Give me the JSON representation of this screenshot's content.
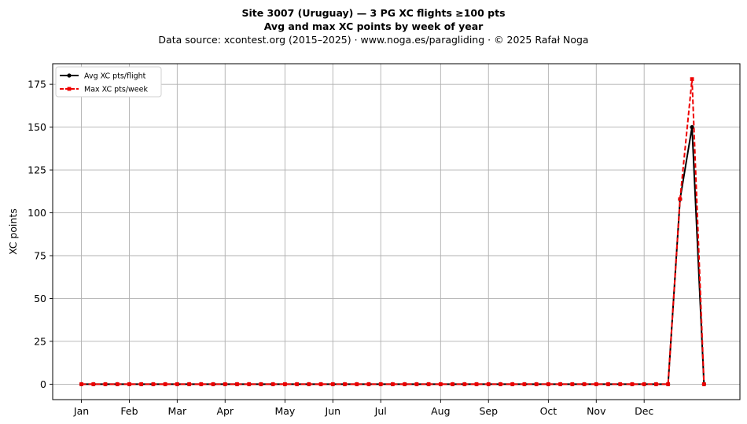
{
  "title": {
    "line1": "Site 3007 (Uruguay)  —  3 PG XC flights ≥100 pts",
    "line2": "Avg and max XC points by week of year",
    "line3": "Data source: xcontest.org (2015–2025)  ·  www.noga.es/paragliding  ·  © 2025 Rafał Noga"
  },
  "chart_data": {
    "type": "line",
    "title": "Site 3007 (Uruguay)  —  3 PG XC flights ≥100 pts",
    "subtitle": "Avg and max XC points by week of year",
    "xlabel": "",
    "ylabel": "XC points",
    "x": [
      1,
      2,
      3,
      4,
      5,
      6,
      7,
      8,
      9,
      10,
      11,
      12,
      13,
      14,
      15,
      16,
      17,
      18,
      19,
      20,
      21,
      22,
      23,
      24,
      25,
      26,
      27,
      28,
      29,
      30,
      31,
      32,
      33,
      34,
      35,
      36,
      37,
      38,
      39,
      40,
      41,
      42,
      43,
      44,
      45,
      46,
      47,
      48,
      49,
      50,
      51,
      52,
      53
    ],
    "xlim": [
      -1.4,
      56.0
    ],
    "ylim": [
      -9,
      187
    ],
    "x_ticks": [
      {
        "label": "Jan",
        "pos": 1
      },
      {
        "label": "Feb",
        "pos": 5
      },
      {
        "label": "Mar",
        "pos": 9
      },
      {
        "label": "Apr",
        "pos": 13
      },
      {
        "label": "May",
        "pos": 18
      },
      {
        "label": "Jun",
        "pos": 22
      },
      {
        "label": "Jul",
        "pos": 26
      },
      {
        "label": "Aug",
        "pos": 31
      },
      {
        "label": "Sep",
        "pos": 35
      },
      {
        "label": "Oct",
        "pos": 40
      },
      {
        "label": "Nov",
        "pos": 44
      },
      {
        "label": "Dec",
        "pos": 48
      }
    ],
    "y_ticks": [
      0,
      25,
      50,
      75,
      100,
      125,
      150,
      175
    ],
    "grid": true,
    "legend_position": "top-left",
    "series": [
      {
        "name": "Avg XC pts/flight",
        "color": "#000000",
        "style": "solid",
        "marker": "circle",
        "values": [
          0,
          0,
          0,
          0,
          0,
          0,
          0,
          0,
          0,
          0,
          0,
          0,
          0,
          0,
          0,
          0,
          0,
          0,
          0,
          0,
          0,
          0,
          0,
          0,
          0,
          0,
          0,
          0,
          0,
          0,
          0,
          0,
          0,
          0,
          0,
          0,
          0,
          0,
          0,
          0,
          0,
          0,
          0,
          0,
          0,
          0,
          0,
          0,
          0,
          0,
          108,
          150,
          0
        ]
      },
      {
        "name": "Max XC pts/week",
        "color": "#ee0000",
        "style": "dashed",
        "marker": "square",
        "values": [
          0,
          0,
          0,
          0,
          0,
          0,
          0,
          0,
          0,
          0,
          0,
          0,
          0,
          0,
          0,
          0,
          0,
          0,
          0,
          0,
          0,
          0,
          0,
          0,
          0,
          0,
          0,
          0,
          0,
          0,
          0,
          0,
          0,
          0,
          0,
          0,
          0,
          0,
          0,
          0,
          0,
          0,
          0,
          0,
          0,
          0,
          0,
          0,
          0,
          0,
          108,
          178,
          0
        ]
      }
    ]
  }
}
